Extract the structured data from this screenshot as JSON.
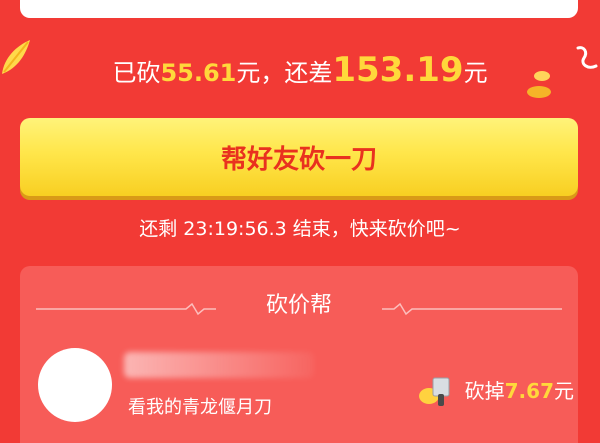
{
  "progress": {
    "cut_prefix": "已砍",
    "cut_amount": "55.61",
    "cut_unit": "元，",
    "remain_prefix": "还差",
    "remain_amount": "153.19",
    "remain_unit": "元"
  },
  "primary_button_label": "帮好友砍一刀",
  "countdown_text": "还剩 23:19:56.3 结束，快来砍价吧~",
  "helpers": {
    "title": "砍价帮",
    "items": [
      {
        "message": "看我的青龙偃月刀",
        "cut_prefix": "砍掉",
        "cut_amount": "7.67",
        "cut_unit": "元"
      }
    ]
  },
  "colors": {
    "background": "#f23a35",
    "button": "#ffe64a",
    "accent_number": "#ffd83b",
    "button_text": "#e9311f"
  },
  "icons": [
    "banana-leaf-icon",
    "rope-icon",
    "coin-icon",
    "cleaver-icon",
    "heartbeat-line-icon"
  ]
}
